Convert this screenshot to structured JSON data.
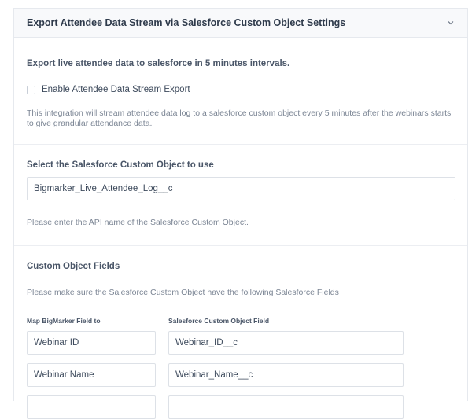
{
  "panel": {
    "title": "Export Attendee Data Stream via Salesforce Custom Object Settings",
    "collapse_icon": "chevron-down-icon"
  },
  "stream": {
    "heading": "Export live attendee data to salesforce in 5 minutes intervals.",
    "checkbox_label": "Enable Attendee Data Stream Export",
    "checkbox_checked": false,
    "description": "This integration will stream attendee data log to a salesforce custom object every 5 minutes after the webinars starts to give grandular attendance data."
  },
  "custom_object": {
    "heading": "Select the Salesforce Custom Object to use",
    "value": "Bigmarker_Live_Attendee_Log__c",
    "help": "Please enter the API name of the Salesforce Custom Object."
  },
  "fields": {
    "heading": "Custom Object Fields",
    "help": "Please make sure the Salesforce Custom Object have the following Salesforce Fields",
    "col_left": "Map BigMarker Field to",
    "col_right": "Salesforce Custom Object Field",
    "rows": [
      {
        "bigmarker": "Webinar ID",
        "salesforce": "Webinar_ID__c"
      },
      {
        "bigmarker": "Webinar Name",
        "salesforce": "Webinar_Name__c"
      },
      {
        "bigmarker": "",
        "salesforce": ""
      }
    ]
  },
  "colors": {
    "header_bg": "#f8f9fb",
    "border": "#e6e9ee",
    "text_dark": "#2f3b4c",
    "text_muted": "#7b8594"
  }
}
